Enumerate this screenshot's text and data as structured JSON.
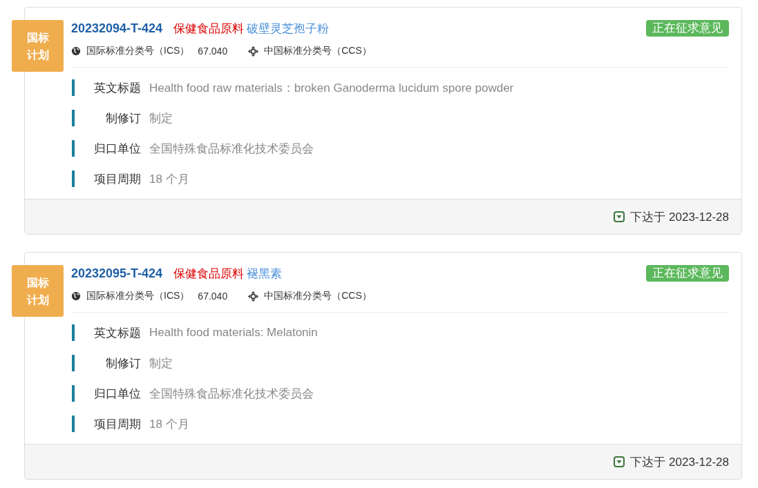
{
  "cards": [
    {
      "badge": "国标计划",
      "code": "20232094-T-424",
      "category": "保健食品原料",
      "name": "破壁灵芝孢子粉",
      "status": "正在征求意见",
      "ics_label": "国际标准分类号（ICS）",
      "ics_value": "67.040",
      "ccs_label": "中国标准分类号（CCS）",
      "fields": [
        {
          "label": "英文标题",
          "value": "Health food raw materials：broken Ganoderma lucidum spore powder"
        },
        {
          "label": "制修订",
          "value": "制定"
        },
        {
          "label": "归口单位",
          "value": "全国特殊食品标准化技术委员会"
        },
        {
          "label": "项目周期",
          "value": "18 个月"
        }
      ],
      "issued": "下达于 2023-12-28"
    },
    {
      "badge": "国标计划",
      "code": "20232095-T-424",
      "category": "保健食品原料",
      "name": "褪黑素",
      "status": "正在征求意见",
      "ics_label": "国际标准分类号（ICS）",
      "ics_value": "67.040",
      "ccs_label": "中国标准分类号（CCS）",
      "fields": [
        {
          "label": "英文标题",
          "value": "Health food materials: Melatonin"
        },
        {
          "label": "制修订",
          "value": "制定"
        },
        {
          "label": "归口单位",
          "value": "全国特殊食品标准化技术委员会"
        },
        {
          "label": "项目周期",
          "value": "18 个月"
        }
      ],
      "issued": "下达于 2023-12-28"
    }
  ]
}
